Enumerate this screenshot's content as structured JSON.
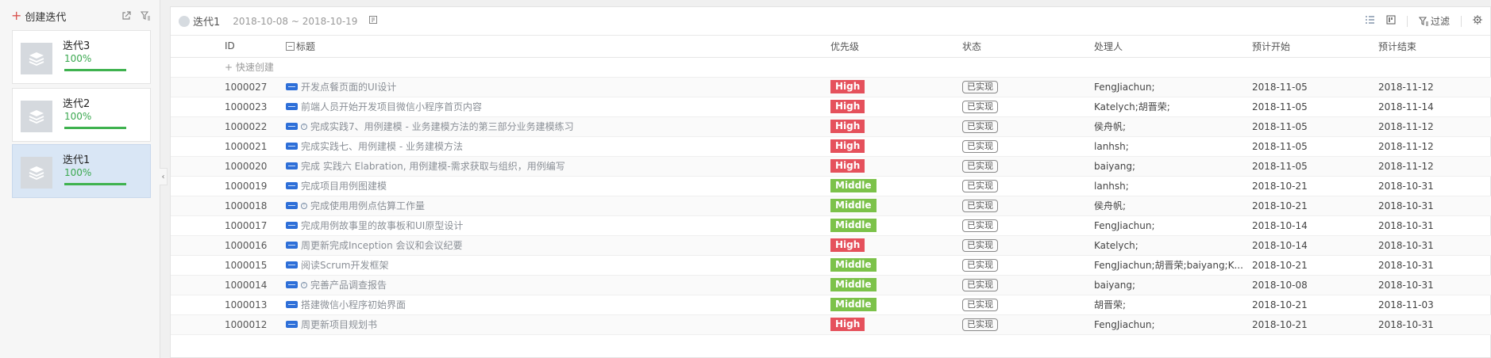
{
  "sidebar": {
    "create_label": "创建迭代",
    "iterations": [
      {
        "name": "迭代3",
        "progress_label": "100%",
        "progress": 1.0
      },
      {
        "name": "迭代2",
        "progress_label": "100%",
        "progress": 1.0
      },
      {
        "name": "迭代1",
        "progress_label": "100%",
        "progress": 1.0
      }
    ],
    "active_index": 2
  },
  "header": {
    "sprint_name": "迭代1",
    "date_range": "2018-10-08 ~ 2018-10-19",
    "filter_label": "过滤"
  },
  "table": {
    "columns": [
      "ID",
      "标题",
      "优先级",
      "状态",
      "处理人",
      "预计开始",
      "预计结束"
    ],
    "quick_create_label": "快速创建",
    "rows": [
      {
        "id": "1000027",
        "info": false,
        "title": "开发点餐页面的UI设计",
        "priority": "High",
        "status": "已实现",
        "owner": "FengJiachun;",
        "start": "2018-11-05",
        "end": "2018-11-12"
      },
      {
        "id": "1000023",
        "info": false,
        "title": "前端人员开始开发项目微信小程序首页内容",
        "priority": "High",
        "status": "已实现",
        "owner": "Katelych;胡晋荣;",
        "start": "2018-11-05",
        "end": "2018-11-14"
      },
      {
        "id": "1000022",
        "info": true,
        "title": "完成实践7、用例建模 - 业务建模方法的第三部分业务建模练习",
        "priority": "High",
        "status": "已实现",
        "owner": "侯舟帆;",
        "start": "2018-11-05",
        "end": "2018-11-12"
      },
      {
        "id": "1000021",
        "info": false,
        "title": "完成实践七、用例建模 - 业务建模方法",
        "priority": "High",
        "status": "已实现",
        "owner": "lanhsh;",
        "start": "2018-11-05",
        "end": "2018-11-12"
      },
      {
        "id": "1000020",
        "info": false,
        "title": "完成 实践六 Elabration, 用例建模-需求获取与组织，用例编写",
        "priority": "High",
        "status": "已实现",
        "owner": "baiyang;",
        "start": "2018-11-05",
        "end": "2018-11-12"
      },
      {
        "id": "1000019",
        "info": false,
        "title": "完成项目用例图建模",
        "priority": "Middle",
        "status": "已实现",
        "owner": "lanhsh;",
        "start": "2018-10-21",
        "end": "2018-10-31"
      },
      {
        "id": "1000018",
        "info": true,
        "title": "完成使用用例点估算工作量",
        "priority": "Middle",
        "status": "已实现",
        "owner": "侯舟帆;",
        "start": "2018-10-21",
        "end": "2018-10-31"
      },
      {
        "id": "1000017",
        "info": false,
        "title": "完成用例故事里的故事板和UI原型设计",
        "priority": "Middle",
        "status": "已实现",
        "owner": "FengJiachun;",
        "start": "2018-10-14",
        "end": "2018-10-31"
      },
      {
        "id": "1000016",
        "info": false,
        "title": "周更新完成Inception 会议和会议纪要",
        "priority": "High",
        "status": "已实现",
        "owner": "Katelych;",
        "start": "2018-10-14",
        "end": "2018-10-31"
      },
      {
        "id": "1000015",
        "info": false,
        "title": "阅读Scrum开发框架",
        "priority": "Middle",
        "status": "已实现",
        "owner": "FengJiachun;胡晋荣;baiyang;K...",
        "start": "2018-10-21",
        "end": "2018-10-31"
      },
      {
        "id": "1000014",
        "info": true,
        "title": "完善产品调查报告",
        "priority": "Middle",
        "status": "已实现",
        "owner": "baiyang;",
        "start": "2018-10-08",
        "end": "2018-10-31"
      },
      {
        "id": "1000013",
        "info": false,
        "title": "搭建微信小程序初始界面",
        "priority": "Middle",
        "status": "已实现",
        "owner": "胡晋荣;",
        "start": "2018-10-21",
        "end": "2018-11-03"
      },
      {
        "id": "1000012",
        "info": false,
        "title": "周更新项目规划书",
        "priority": "High",
        "status": "已实现",
        "owner": "FengJiachun;",
        "start": "2018-10-21",
        "end": "2018-10-31"
      }
    ]
  },
  "colors": {
    "high": "#e5515c",
    "middle": "#7cc24a",
    "progress": "#3fb24f",
    "active_card": "#d9e6f5"
  }
}
